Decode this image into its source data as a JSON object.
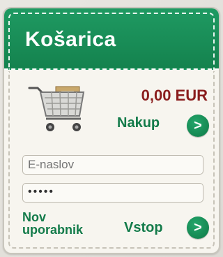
{
  "cart": {
    "title": "Košarica",
    "total": "0,00 EUR",
    "checkout_label": "Nakup",
    "checkout_icon": "arrow-right-icon"
  },
  "login": {
    "email_placeholder": "E-naslov",
    "password_value": "•••••",
    "new_user_label": "Nov uporabnik",
    "login_label": "Vstop",
    "login_icon": "arrow-right-icon"
  },
  "colors": {
    "header_green": "#14824e",
    "text_green": "#137b4a",
    "price_red": "#8a1d1d",
    "panel_bg": "#f7f5ef"
  }
}
